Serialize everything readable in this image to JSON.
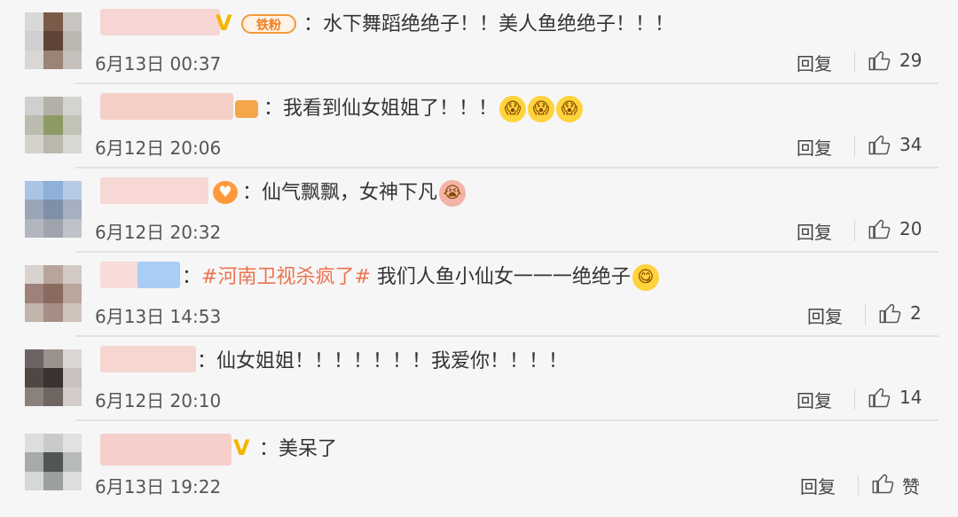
{
  "comments": [
    {
      "text": "：水下舞蹈绝绝子！！美人鱼绝绝子！！！",
      "fan_badge": "铁粉",
      "time": "6月13日 00:37",
      "reply": "回复",
      "likes": "29"
    },
    {
      "text": "：我看到仙女姐姐了！！！",
      "time": "6月12日 20:06",
      "reply": "回复",
      "likes": "34"
    },
    {
      "text": "：仙气飘飘，女神下凡",
      "time": "6月12日 20:32",
      "reply": "回复",
      "likes": "20"
    },
    {
      "text_prefix": "：",
      "topic": "#河南卫视杀疯了#",
      "text": " 我们人鱼小仙女一一一绝绝子",
      "time": "6月13日 14:53",
      "reply": "回复",
      "likes": "2"
    },
    {
      "text": "：仙女姐姐！！！！！！！我爱你！！！！",
      "time": "6月12日 20:10",
      "reply": "回复",
      "likes": "14"
    },
    {
      "text": "：美呆了",
      "verified_badge": "V",
      "time": "6月13日 19:22",
      "reply": "回复",
      "likes": "赞"
    }
  ],
  "colors": {
    "topic": "#eb7350",
    "verified": "#f4b400",
    "fan_badge": "#f07b1c"
  }
}
